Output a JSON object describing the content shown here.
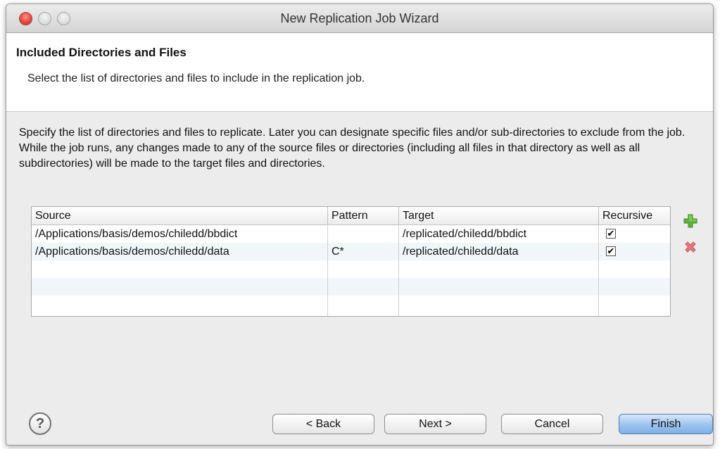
{
  "window": {
    "title": "New Replication Job Wizard"
  },
  "header": {
    "title": "Included Directories and Files",
    "description": "Select the list of directories and files to include in the replication job."
  },
  "body": {
    "description": "Specify the list of directories and files to replicate.  Later you can designate specific files and/or sub-directories to exclude from the job.  While the job runs, any changes made to any of the source files or directories (including all files in that directory as well as all subdirectories) will be made to the target files and directories."
  },
  "table": {
    "columns": [
      "Source",
      "Pattern",
      "Target",
      "Recursive"
    ],
    "rows": [
      {
        "source": "/Applications/basis/demos/chiledd/bbdict",
        "pattern": "",
        "target": "/replicated/chiledd/bbdict",
        "recursive": true
      },
      {
        "source": "/Applications/basis/demos/chiledd/data",
        "pattern": "C*",
        "target": "/replicated/chiledd/data",
        "recursive": true
      }
    ],
    "check_mark": "✔"
  },
  "icons": {
    "add": "plus-icon",
    "remove": "x-icon",
    "help": "question-icon"
  },
  "footer": {
    "help_symbol": "?",
    "back_label": "< Back",
    "next_label": "Next >",
    "cancel_label": "Cancel",
    "finish_label": "Finish"
  },
  "colors": {
    "add_icon": "#5fb33a",
    "remove_icon": "#e07a7a",
    "default_button": "#9cc3ee"
  }
}
